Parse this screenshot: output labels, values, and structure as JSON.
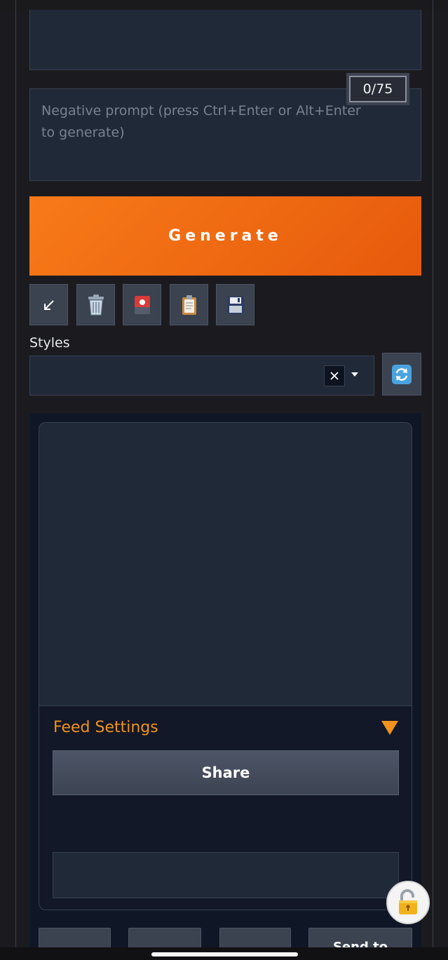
{
  "prompt": {
    "negative_placeholder": "Negative prompt (press Ctrl+Enter or Alt+Enter to generate)",
    "token_counter": "0/75"
  },
  "generate": {
    "label": "Generate",
    "accent": "#f0701a"
  },
  "toolbar": [
    {
      "name": "arrow-down-left-icon"
    },
    {
      "name": "trash-icon"
    },
    {
      "name": "picture-card-icon"
    },
    {
      "name": "clipboard-icon"
    },
    {
      "name": "floppy-disk-icon"
    }
  ],
  "styles": {
    "label": "Styles",
    "value": "",
    "clear_icon": "close-icon",
    "dropdown_icon": "chevron-down-icon",
    "refresh_icon": "refresh-icon"
  },
  "feed_settings": {
    "title": "Feed Settings",
    "title_color": "#f0921c",
    "share_label": "Share"
  },
  "bottom_buttons": [
    "",
    "",
    "",
    "Send to"
  ],
  "lock_icon": "unlocked-padlock-icon"
}
